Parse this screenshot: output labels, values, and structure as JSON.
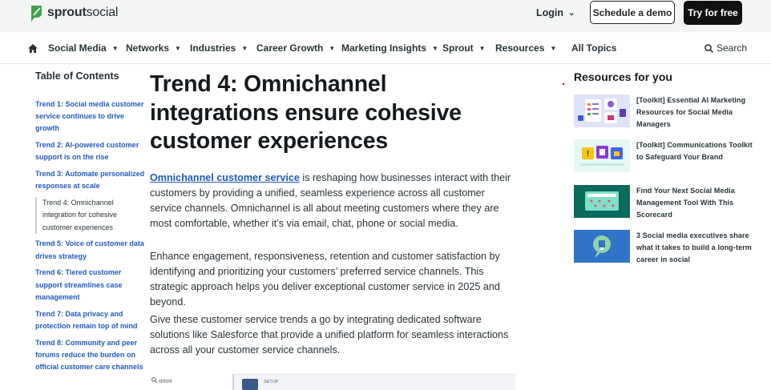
{
  "header": {
    "logo_text_bold": "sprout",
    "logo_text_rest": "social",
    "login_label": "Login",
    "demo_label": "Schedule a demo",
    "free_label": "Try for free"
  },
  "nav": {
    "items": [
      {
        "label": "Social Media"
      },
      {
        "label": "Networks"
      },
      {
        "label": "Industries"
      },
      {
        "label": "Career Growth"
      },
      {
        "label": "Marketing Insights"
      },
      {
        "label": "Sprout"
      },
      {
        "label": "Resources"
      },
      {
        "label": "All Topics"
      }
    ],
    "search_label": "Search"
  },
  "toc": {
    "title": "Table of Contents",
    "items": [
      {
        "label": "Trend 1: Social media customer service continues to drive growth"
      },
      {
        "label": "Trend 2: AI-powered customer support is on the rise"
      },
      {
        "label": "Trend 3: Automate personalized responses at scale"
      },
      {
        "label": "Trend 4: Omnichannel integration for cohesive customer experiences"
      },
      {
        "label": "Trend 5: Voice of customer data drives strategy"
      },
      {
        "label": "Trend 6: Tiered customer support streamlines case management"
      },
      {
        "label": "Trend 7: Data privacy and protection remain top of mind"
      },
      {
        "label": "Trend 8: Community and peer forums reduce the burden on official customer care channels"
      }
    ]
  },
  "article": {
    "heading": "Trend 4: Omnichannel integrations ensure cohesive customer experiences",
    "p1_link": "Omnichannel customer service",
    "p1_rest": " is reshaping how businesses interact with their customers by providing a unified, seamless experience across all customer service channels. Omnichannel is all about meeting customers where they are most comfortable, whether it’s via email, chat, phone or social media.",
    "p2": "Enhance engagement, responsiveness, retention and customer satisfaction by identifying and prioritizing your customers’ preferred service channels. This strategic approach helps you deliver exceptional customer service in 2025 and beyond.",
    "p3": "Give these customer service trends a go by integrating dedicated software solutions like Salesforce that provide a unified platform for seamless interactions across all your customer service channels.",
    "preview_search": "omni",
    "preview_setup": "SETUP"
  },
  "resources": {
    "title": "Resources for you",
    "items": [
      {
        "label": "[Toolkit] Essential AI Marketing Resources for Social Media Managers"
      },
      {
        "label": "[Toolkit] Communications Toolkit to Safeguard Your Brand"
      },
      {
        "label": "Find Your Next Social Media Management Tool With This Scorecard"
      },
      {
        "label": "3 Social media executives share what it takes to build a long-term career in social"
      }
    ]
  },
  "colors": {
    "brand_green": "#3fa34d",
    "link_blue": "#205bb8",
    "dark": "#0f1113"
  }
}
